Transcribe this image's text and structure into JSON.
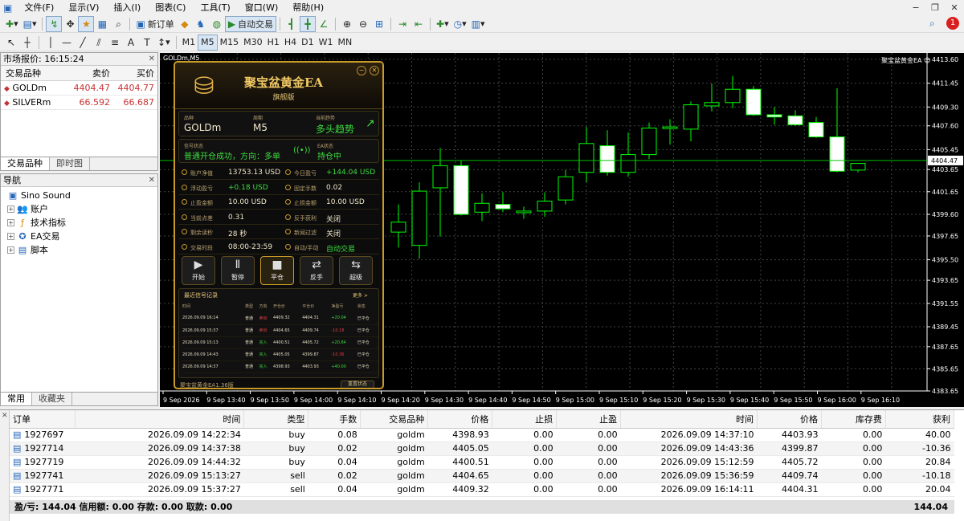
{
  "menu": [
    "文件(F)",
    "显示(V)",
    "插入(I)",
    "图表(C)",
    "工具(T)",
    "窗口(W)",
    "帮助(H)"
  ],
  "toolbar1": {
    "new_order": "新订单",
    "auto_trade": "自动交易"
  },
  "toolbar2": {
    "timeframes": [
      "M1",
      "M5",
      "M15",
      "M30",
      "H1",
      "H4",
      "D1",
      "W1",
      "MN"
    ],
    "active_tf": "M5"
  },
  "market_watch": {
    "title": "市场报价: 16:15:24",
    "headers": [
      "交易品种",
      "卖价",
      "买价"
    ],
    "rows": [
      {
        "symbol": "GOLDm",
        "bid": "4404.47",
        "ask": "4404.77"
      },
      {
        "symbol": "SILVERm",
        "bid": "66.592",
        "ask": "66.687"
      }
    ],
    "tabs": [
      "交易品种",
      "即时图"
    ]
  },
  "navigator": {
    "title": "导航",
    "root": "Sino Sound",
    "items": [
      "账户",
      "技术指标",
      "EA交易",
      "脚本"
    ],
    "tabs": [
      "常用",
      "收藏夹"
    ]
  },
  "chart": {
    "title": "GOLDm,M5",
    "ea_label": "聚宝盆黄金EA",
    "current_price": "4404.47",
    "price_ticks": [
      "4413.60",
      "4411.45",
      "4409.30",
      "4407.60",
      "4405.45",
      "4403.65",
      "4401.65",
      "4399.60",
      "4397.65",
      "4395.50",
      "4393.65",
      "4391.55",
      "4389.45",
      "4387.65",
      "4385.65",
      "4383.65"
    ],
    "time_ticks": [
      "9 Sep 2026",
      "9 Sep 13:40",
      "9 Sep 13:50",
      "9 Sep 14:00",
      "9 Sep 14:10",
      "9 Sep 14:20",
      "9 Sep 14:30",
      "9 Sep 14:40",
      "9 Sep 14:50",
      "9 Sep 15:00",
      "9 Sep 15:10",
      "9 Sep 15:20",
      "9 Sep 15:30",
      "9 Sep 15:40",
      "9 Sep 15:50",
      "9 Sep 16:00",
      "9 Sep 16:10"
    ],
    "colors": {
      "bg": "#000000",
      "bull_border": "#00ff00",
      "bear_fill": "#ffffff",
      "grid": "#444444"
    }
  },
  "chart_data": {
    "type": "candlestick",
    "ylim": [
      4383.65,
      4413.6
    ],
    "candles": [
      {
        "o": 4398.0,
        "h": 4400.5,
        "l": 4396.6,
        "c": 4398.9
      },
      {
        "o": 4396.8,
        "h": 4402.5,
        "l": 4395.6,
        "c": 4401.7
      },
      {
        "o": 4402.0,
        "h": 4405.6,
        "l": 4397.6,
        "c": 4404.0
      },
      {
        "o": 4404.0,
        "h": 4404.5,
        "l": 4399.5,
        "c": 4399.6
      },
      {
        "o": 4399.8,
        "h": 4401.5,
        "l": 4399.0,
        "c": 4400.6
      },
      {
        "o": 4400.5,
        "h": 4401.6,
        "l": 4399.8,
        "c": 4400.1
      },
      {
        "o": 4399.8,
        "h": 4400.3,
        "l": 4399.2,
        "c": 4399.9
      },
      {
        "o": 4399.9,
        "h": 4401.6,
        "l": 4399.4,
        "c": 4400.8
      },
      {
        "o": 4400.9,
        "h": 4403.6,
        "l": 4400.5,
        "c": 4403.0
      },
      {
        "o": 4403.4,
        "h": 4407.5,
        "l": 4402.5,
        "c": 4406.0
      },
      {
        "o": 4405.8,
        "h": 4407.2,
        "l": 4403.1,
        "c": 4403.4
      },
      {
        "o": 4403.4,
        "h": 4407.0,
        "l": 4403.0,
        "c": 4405.0
      },
      {
        "o": 4405.0,
        "h": 4407.9,
        "l": 4404.6,
        "c": 4407.4
      },
      {
        "o": 4407.4,
        "h": 4408.2,
        "l": 4405.9,
        "c": 4407.5
      },
      {
        "o": 4407.3,
        "h": 4409.8,
        "l": 4406.2,
        "c": 4409.5
      },
      {
        "o": 4409.4,
        "h": 4411.4,
        "l": 4408.9,
        "c": 4409.7
      },
      {
        "o": 4409.7,
        "h": 4412.1,
        "l": 4409.2,
        "c": 4410.9
      },
      {
        "o": 4410.9,
        "h": 4411.2,
        "l": 4408.5,
        "c": 4408.6
      },
      {
        "o": 4408.6,
        "h": 4409.3,
        "l": 4407.7,
        "c": 4408.4
      },
      {
        "o": 4408.5,
        "h": 4409.0,
        "l": 4407.6,
        "c": 4407.7
      },
      {
        "o": 4407.9,
        "h": 4408.4,
        "l": 4406.5,
        "c": 4406.6
      },
      {
        "o": 4406.6,
        "h": 4411.0,
        "l": 4403.4,
        "c": 4403.5
      },
      {
        "o": 4403.6,
        "h": 4404.2,
        "l": 4403.4,
        "c": 4404.2
      }
    ]
  },
  "ea": {
    "title": "聚宝盆黄金EA",
    "subtitle": "旗舰版",
    "symbol_label": "品种",
    "symbol": "GOLDm",
    "period_label": "周期",
    "period": "M5",
    "trend_label": "当前趋势",
    "trend": "多头趋势",
    "signal_label": "信号状态",
    "signal": "普通开仓成功，方向：多单",
    "ea_state_label": "EA状态",
    "ea_state": "持仓中",
    "stats": [
      {
        "k1": "账户净值",
        "v1": "13753.13 USD",
        "k2": "今日盈亏",
        "v2": "+144.04 USD",
        "c2": "g"
      },
      {
        "k1": "浮动盈亏",
        "v1": "+0.18 USD",
        "c1": "g",
        "k2": "固定手数",
        "v2": "0.02"
      },
      {
        "k1": "止盈金额",
        "v1": "10.00 USD",
        "k2": "止损金额",
        "v2": "10.00 USD"
      },
      {
        "k1": "当前点差",
        "v1": "0.31",
        "k2": "反手获利",
        "v2": "关闭"
      },
      {
        "k1": "剩余读秒",
        "v1": "28 秒",
        "k2": "新闻过滤",
        "v2": "关闭"
      },
      {
        "k1": "交易时段",
        "v1": "08:00-23:59",
        "k2": "自动/手动",
        "v2": "自动交易",
        "c2": "g"
      }
    ],
    "controls": [
      {
        "icon": "▶",
        "label": "开始"
      },
      {
        "icon": "Ⅱ",
        "label": "暂停"
      },
      {
        "icon": "■",
        "label": "平仓"
      },
      {
        "icon": "⇄",
        "label": "反手"
      },
      {
        "icon": "⇆",
        "label": "超级"
      }
    ],
    "signals_title": "最近信号记录",
    "signals_more": "更多 >",
    "signal_headers": [
      "时间",
      "类型",
      "方向",
      "开仓价",
      "平仓价",
      "净盈亏",
      "状态"
    ],
    "signals": [
      {
        "time": "2026.09.09 16:14",
        "type": "普通",
        "dir": "卖出",
        "open": "4409.32",
        "close": "4404.31",
        "pnl": "+20.04",
        "status": "已平仓"
      },
      {
        "time": "2026.09.09 15:37",
        "type": "普通",
        "dir": "卖出",
        "open": "4404.65",
        "close": "4409.74",
        "pnl": "-10.18",
        "status": "已平仓"
      },
      {
        "time": "2026.09.09 15:13",
        "type": "普通",
        "dir": "买入",
        "open": "4400.51",
        "close": "4405.72",
        "pnl": "+20.84",
        "status": "已平仓"
      },
      {
        "time": "2026.09.09 14:43",
        "type": "普通",
        "dir": "买入",
        "open": "4405.05",
        "close": "4399.87",
        "pnl": "-10.36",
        "status": "已平仓"
      },
      {
        "time": "2026.09.09 14:37",
        "type": "普通",
        "dir": "买入",
        "open": "4398.93",
        "close": "4403.93",
        "pnl": "+40.00",
        "status": "已平仓"
      }
    ],
    "footer": "聚宝盆黄金EA1.36版",
    "footer_btn": "重置状态"
  },
  "terminal": {
    "headers": [
      "订单",
      "时间",
      "类型",
      "手数",
      "交易品种",
      "价格",
      "止损",
      "止盈",
      "时间",
      "价格",
      "库存费",
      "获利"
    ],
    "rows": [
      [
        "1927697",
        "2026.09.09 14:22:34",
        "buy",
        "0.08",
        "goldm",
        "4398.93",
        "0.00",
        "0.00",
        "2026.09.09 14:37:10",
        "4403.93",
        "0.00",
        "40.00"
      ],
      [
        "1927714",
        "2026.09.09 14:37:38",
        "buy",
        "0.02",
        "goldm",
        "4405.05",
        "0.00",
        "0.00",
        "2026.09.09 14:43:36",
        "4399.87",
        "0.00",
        "-10.36"
      ],
      [
        "1927719",
        "2026.09.09 14:44:32",
        "buy",
        "0.04",
        "goldm",
        "4400.51",
        "0.00",
        "0.00",
        "2026.09.09 15:12:59",
        "4405.72",
        "0.00",
        "20.84"
      ],
      [
        "1927741",
        "2026.09.09 15:13:27",
        "sell",
        "0.02",
        "goldm",
        "4404.65",
        "0.00",
        "0.00",
        "2026.09.09 15:36:59",
        "4409.74",
        "0.00",
        "-10.18"
      ],
      [
        "1927771",
        "2026.09.09 15:37:27",
        "sell",
        "0.04",
        "goldm",
        "4409.32",
        "0.00",
        "0.00",
        "2026.09.09 16:14:11",
        "4404.31",
        "0.00",
        "20.04"
      ]
    ],
    "summary": "盈/亏: 144.04  信用额: 0.00  存款: 0.00  取款: 0.00",
    "total": "144.04"
  }
}
